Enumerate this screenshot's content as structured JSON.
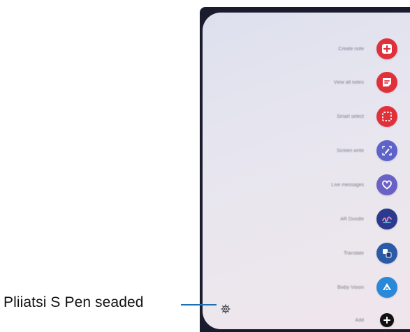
{
  "callout": {
    "text": "Pliiatsi S Pen seaded"
  },
  "colors": {
    "callout_line": "#1f6fb6",
    "red": "#e0313b",
    "indigo": "#5d63c9",
    "violet": "#6a61c6",
    "navy": "#2b3a8e",
    "blue": "#2b5aa6",
    "azure": "#2a88d8",
    "black": "#111111"
  },
  "menu": {
    "items": [
      {
        "label": "Create note",
        "icon": "note-plus-icon",
        "color": "#e0313b"
      },
      {
        "label": "View all notes",
        "icon": "notes-list-icon",
        "color": "#e0313b"
      },
      {
        "label": "Smart select",
        "icon": "dashed-select-icon",
        "color": "#e0313b"
      },
      {
        "label": "Screen write",
        "icon": "screen-write-icon",
        "color": "#5d63c9"
      },
      {
        "label": "Live messages",
        "icon": "heart-message-icon",
        "color": "#6a61c6"
      },
      {
        "label": "AR Doodle",
        "icon": "doodle-icon",
        "color": "#2b3a8e"
      },
      {
        "label": "Translate",
        "icon": "translate-icon",
        "color": "#2b5aa6"
      },
      {
        "label": "Bixby Vision",
        "icon": "vision-icon",
        "color": "#2a88d8"
      },
      {
        "label": "Add",
        "icon": "add-icon",
        "color": "#111111"
      }
    ],
    "settings_icon": "gear-icon"
  }
}
